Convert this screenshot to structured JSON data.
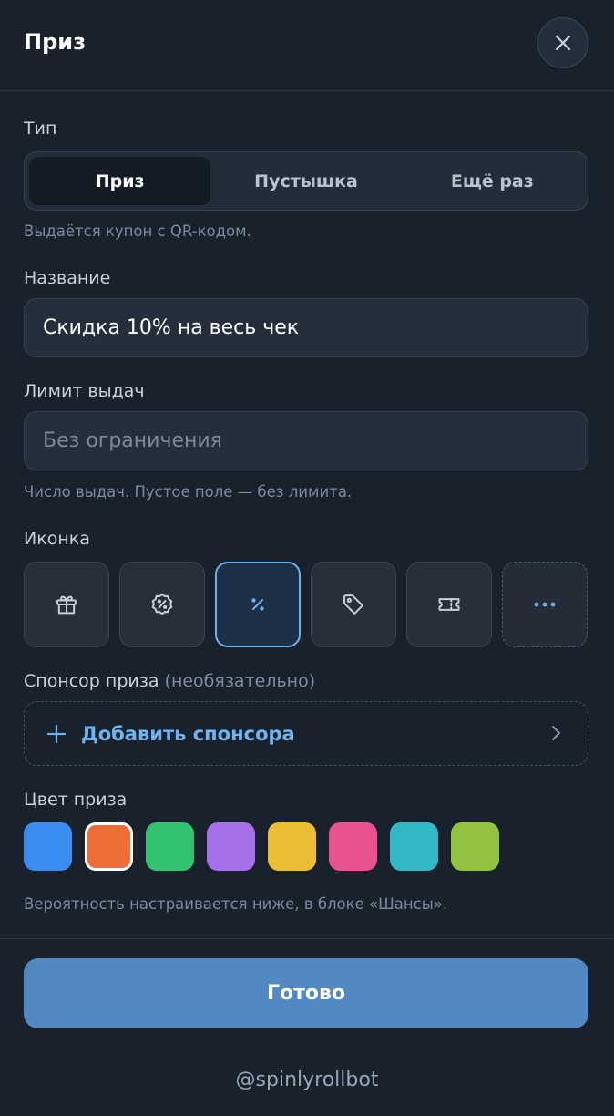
{
  "header": {
    "title": "Приз",
    "close_icon": "close-icon"
  },
  "type_section": {
    "label": "Тип",
    "options": [
      {
        "label": "Приз",
        "selected": true
      },
      {
        "label": "Пустышка",
        "selected": false
      },
      {
        "label": "Ещё раз",
        "selected": false
      }
    ],
    "hint": "Выдаётся купон с QR-кодом."
  },
  "name_section": {
    "label": "Название",
    "value": "Скидка 10% на весь чек"
  },
  "limit_section": {
    "label": "Лимит выдач",
    "placeholder": "Без ограничения",
    "hint": "Число выдач. Пустое поле — без лимита."
  },
  "icon_section": {
    "label": "Иконка",
    "icons": [
      "gift-icon",
      "discount-badge-icon",
      "percent-icon",
      "tag-icon",
      "ticket-icon",
      "more-icon"
    ],
    "selected": "percent-icon"
  },
  "sponsor_section": {
    "label": "Спонсор приза",
    "label_optional": "(необязательно)",
    "add_label": "Добавить спонсора"
  },
  "color_section": {
    "label": "Цвет приза",
    "colors": [
      "#3b8ef0",
      "#ed6e37",
      "#33c36f",
      "#a570ea",
      "#ecbe33",
      "#e9528f",
      "#33b9c5",
      "#92c23e"
    ],
    "selected_color": "#ed6e37",
    "hint": "Вероятность настраивается ниже, в блоке «Шансы»."
  },
  "done_label": "Готово",
  "footer": "@spinlyrollbot",
  "accent_color": "#6fb3f0"
}
